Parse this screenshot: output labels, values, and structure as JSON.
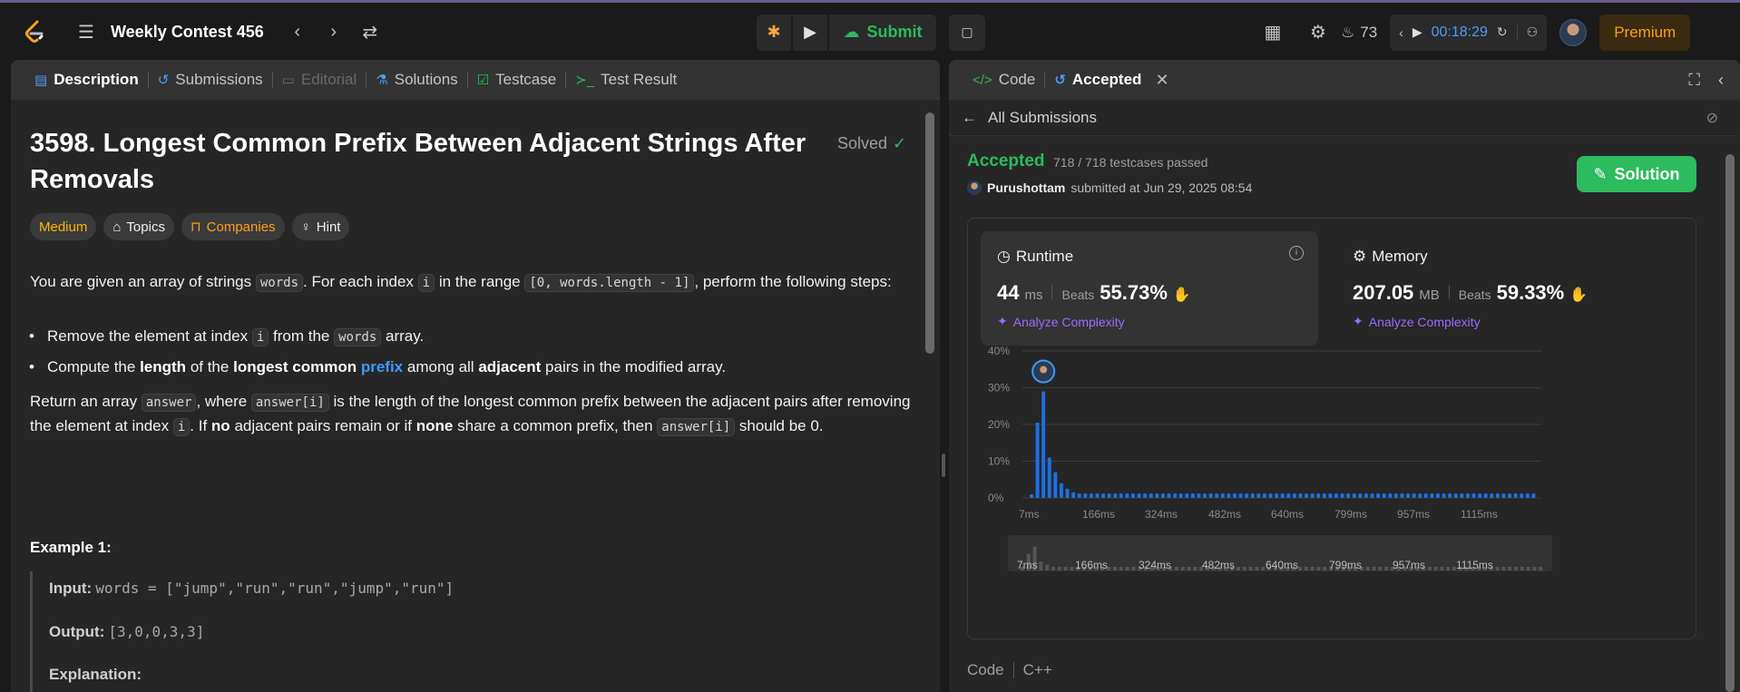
{
  "topbar": {
    "contest_title": "Weekly Contest 456",
    "submit_label": "Submit",
    "streak_count": "73",
    "timer": "00:18:29",
    "premium_label": "Premium"
  },
  "left_tabs": [
    {
      "label": "Description",
      "icon": "description-icon"
    },
    {
      "label": "Submissions",
      "icon": "history-icon"
    },
    {
      "label": "Editorial",
      "icon": "book-icon"
    },
    {
      "label": "Solutions",
      "icon": "flask-icon"
    },
    {
      "label": "Testcase",
      "icon": "checkbox-icon"
    },
    {
      "label": "Test Result",
      "icon": "terminal-icon"
    }
  ],
  "problem": {
    "title": "3598. Longest Common Prefix Between Adjacent Strings After Removals",
    "status": "Solved",
    "difficulty": "Medium",
    "topics_label": "Topics",
    "companies_label": "Companies",
    "hint_label": "Hint",
    "p1_a": "You are given an array of strings",
    "p1_code1": "words",
    "p1_b": ". For each index",
    "p1_code2": "i",
    "p1_c": "in the range",
    "p1_code3": "[0, words.length - 1]",
    "p1_d": ", perform the following steps:",
    "b1_a": "Remove the element at index",
    "b1_code1": "i",
    "b1_b": "from the",
    "b1_code2": "words",
    "b1_c": "array.",
    "b2_a": "Compute the",
    "b2_b1": "length",
    "b2_c": "of the",
    "b2_b2": "longest common",
    "b2_link": "prefix",
    "b2_d": "among all",
    "b2_b3": "adjacent",
    "b2_e": "pairs in the modified array.",
    "p2_a": "Return an array",
    "p2_code1": "answer",
    "p2_b": ", where",
    "p2_code2": "answer[i]",
    "p2_c": "is the length of the longest common prefix between the adjacent pairs after removing the element at index",
    "p2_code3": "i",
    "p2_d": ". If",
    "p2_b1": "no",
    "p2_e": "adjacent pairs remain or if",
    "p2_b2": "none",
    "p2_f": "share a common prefix, then",
    "p2_code4": "answer[i]",
    "p2_g": "should be 0.",
    "example_title": "Example 1:",
    "ex_input_label": "Input:",
    "ex_input_value": "words = [\"jump\",\"run\",\"run\",\"jump\",\"run\"]",
    "ex_output_label": "Output:",
    "ex_output_value": "[3,0,0,3,3]",
    "ex_expl_label": "Explanation:"
  },
  "right_tabs": {
    "code_label": "Code",
    "accepted_label": "Accepted"
  },
  "submission": {
    "back_label": "All Submissions",
    "status": "Accepted",
    "testcases": "718 / 718 testcases passed",
    "user": "Purushottam",
    "submitted_at": "submitted at Jun 29, 2025 08:54",
    "solution_label": "Solution",
    "runtime_label": "Runtime",
    "runtime_value": "44",
    "runtime_unit": "ms",
    "beats_label": "Beats",
    "runtime_beats": "55.73%",
    "memory_label": "Memory",
    "memory_value": "207.05",
    "memory_unit": "MB",
    "memory_beats": "59.33%",
    "analyze_label": "Analyze Complexity",
    "code_label": "Code",
    "lang": "C++"
  },
  "chart_data": {
    "type": "bar",
    "ylabels": [
      "40%",
      "30%",
      "20%",
      "10%",
      "0%"
    ],
    "ylim": [
      0,
      40
    ],
    "xlabels": [
      "7ms",
      "166ms",
      "324ms",
      "482ms",
      "640ms",
      "799ms",
      "957ms",
      "1115ms"
    ],
    "values": [
      1,
      20.5,
      29,
      11,
      7,
      4,
      2.5,
      1.5,
      1.2,
      1.2,
      1.2,
      1.2,
      1.2,
      1.2,
      1.2,
      1.2,
      1.2,
      1.2,
      1.2,
      1.2,
      1.2,
      1.2,
      1.2,
      1.2,
      1.2,
      1.2,
      1.2,
      1.2,
      1.2,
      1.2,
      1.2,
      1.2,
      1.2,
      1.2,
      1.2,
      1.2,
      1.2,
      1.2,
      1.2,
      1.2,
      1.2,
      1.2,
      1.2,
      1.2,
      1.2,
      1.2,
      1.2,
      1.2,
      1.2,
      1.2,
      1.2,
      1.2,
      1.2,
      1.2,
      1.2,
      1.2,
      1.2,
      1.2,
      1.2,
      1.2,
      1.2,
      1.2,
      1.2,
      1.2,
      1.2,
      1.2,
      1.2,
      1.2,
      1.2,
      1.2,
      1.2,
      1.2,
      1.2,
      1.2,
      1.2,
      1.2,
      1.2,
      1.2,
      1.2,
      1.2,
      1.2,
      1.2,
      1.2,
      1.2,
      1.2
    ],
    "user_bar_index": 2,
    "bar_color": "#1e6fe0",
    "grid": true
  }
}
